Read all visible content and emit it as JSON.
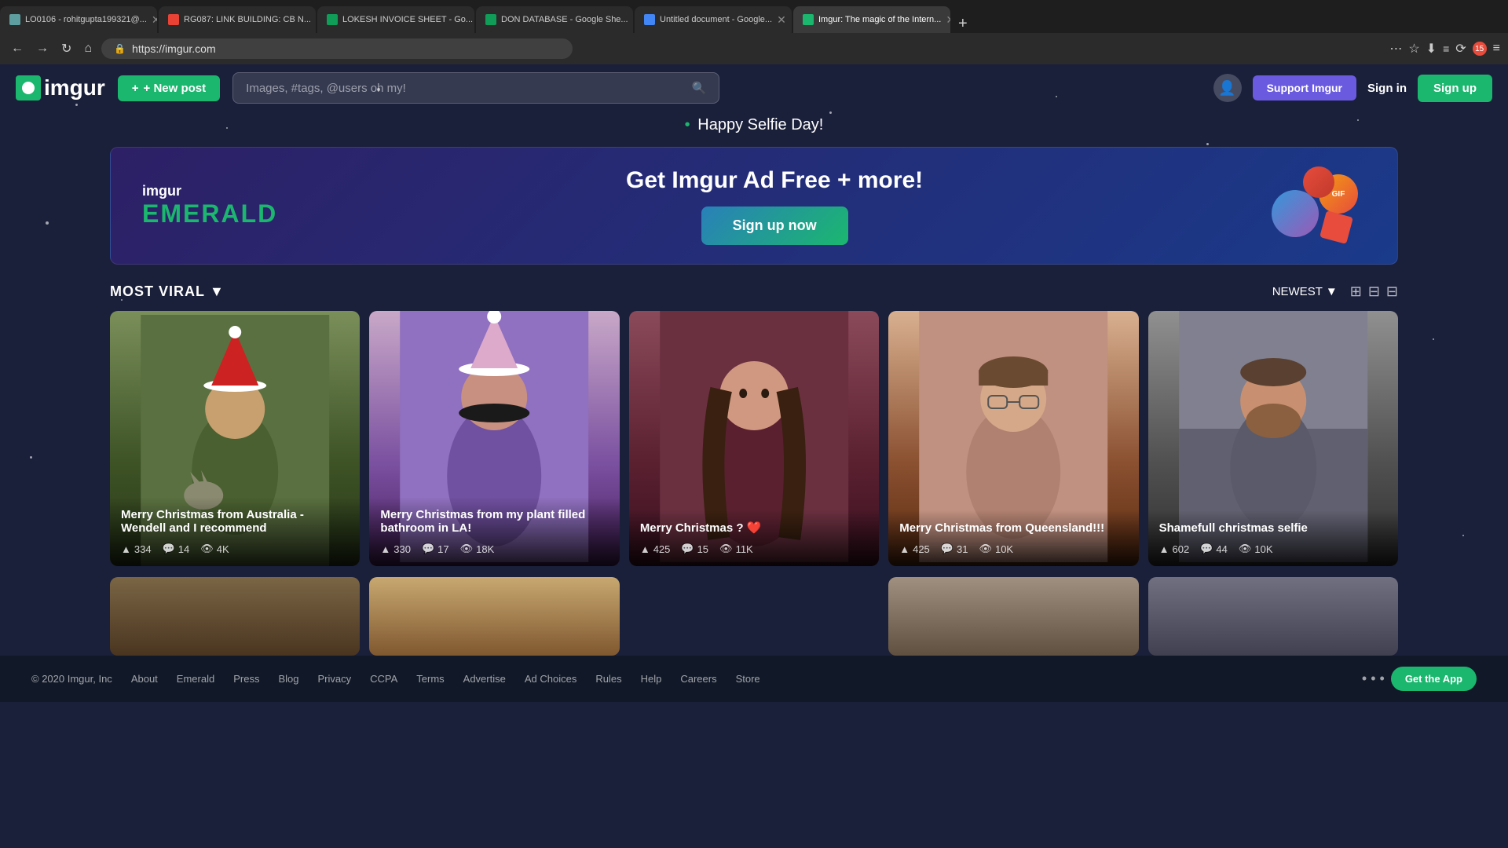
{
  "browser": {
    "tabs": [
      {
        "id": "tab1",
        "favicon": "mail",
        "label": "LO0106 - rohitgupta199321@...",
        "active": false
      },
      {
        "id": "tab2",
        "favicon": "gmail",
        "label": "RG087: LINK BUILDING: CB N...",
        "active": false
      },
      {
        "id": "tab3",
        "favicon": "sheets",
        "label": "LOKESH INVOICE SHEET - Go...",
        "active": false
      },
      {
        "id": "tab4",
        "favicon": "sheets-green",
        "label": "DON DATABASE - Google She...",
        "active": false
      },
      {
        "id": "tab5",
        "favicon": "docs",
        "label": "Untitled document - Google...",
        "active": false
      },
      {
        "id": "tab6",
        "favicon": "imgur",
        "label": "Imgur: The magic of the Intern...",
        "active": true
      }
    ],
    "url": "https://imgur.com"
  },
  "header": {
    "logo_text": "imgur",
    "new_post_label": "+ New post",
    "search_placeholder": "Images, #tags, @users oh my!",
    "support_label": "Support Imgur",
    "signin_label": "Sign in",
    "signup_label": "Sign up"
  },
  "banner": {
    "text": "Happy Selfie Day!"
  },
  "ad": {
    "imgur_text": "imgur",
    "emerald_text": "EMERALD",
    "title": "Get Imgur Ad Free + more!",
    "cta_label": "Sign up now"
  },
  "sort": {
    "label": "MOST VIRAL",
    "newest_label": "NEWEST"
  },
  "cards": [
    {
      "title": "Merry Christmas from Australia - Wendell and I recommend",
      "upvotes": "334",
      "comments": "14",
      "views": "4K",
      "color": "card1"
    },
    {
      "title": "Merry Christmas from my plant filled bathroom in LA!",
      "upvotes": "330",
      "comments": "17",
      "views": "18K",
      "color": "card2"
    },
    {
      "title": "Merry Christmas ? ❤️",
      "upvotes": "425",
      "comments": "15",
      "views": "11K",
      "color": "card3"
    },
    {
      "title": "Merry Christmas from Queensland!!!",
      "upvotes": "425",
      "comments": "31",
      "views": "10K",
      "color": "card4"
    },
    {
      "title": "Shamefull christmas selfie",
      "upvotes": "602",
      "comments": "44",
      "views": "10K",
      "color": "card5"
    }
  ],
  "footer": {
    "copyright": "© 2020 Imgur, Inc",
    "links": [
      "About",
      "Emerald",
      "Press",
      "Blog",
      "Privacy",
      "CCPA",
      "Terms",
      "Advertise",
      "Ad Choices",
      "Rules",
      "Help",
      "Careers",
      "Store"
    ],
    "get_app_label": "Get the App"
  }
}
